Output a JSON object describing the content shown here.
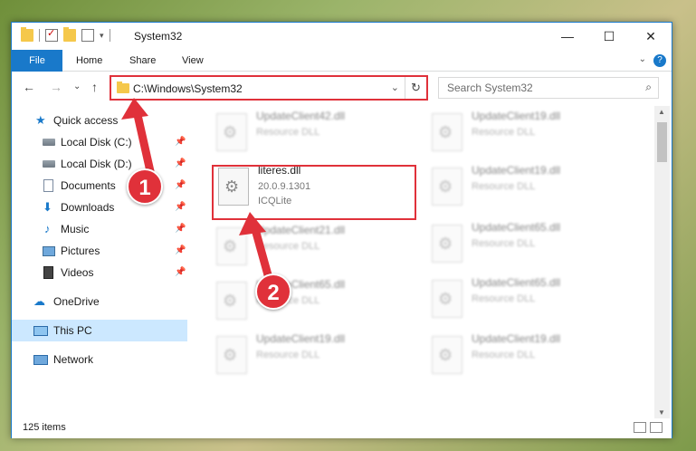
{
  "window": {
    "title": "System32",
    "minimize_glyph": "—",
    "maximize_glyph": "☐",
    "close_glyph": "✕"
  },
  "ribbon": {
    "tabs": [
      "File",
      "Home",
      "Share",
      "View"
    ],
    "help_glyph": "?",
    "collapse_glyph": "⌄"
  },
  "nav": {
    "back_glyph": "←",
    "forward_glyph": "→",
    "recent_glyph": "⌄",
    "up_glyph": "↑",
    "address_path": "C:\\Windows\\System32",
    "address_dropdown_glyph": "⌄",
    "refresh_glyph": "↻",
    "search_placeholder": "Search System32",
    "search_glyph": "⌕"
  },
  "sidebar": {
    "items": [
      {
        "label": "Quick access",
        "icon": "star-icon",
        "glyph": "★"
      },
      {
        "label": "Local Disk (C:)",
        "icon": "drive-icon",
        "pinned": true
      },
      {
        "label": "Local Disk (D:)",
        "icon": "drive-icon",
        "pinned": true
      },
      {
        "label": "Documents",
        "icon": "document-icon",
        "pinned": true
      },
      {
        "label": "Downloads",
        "icon": "download-icon",
        "glyph": "⬇",
        "pinned": true
      },
      {
        "label": "Music",
        "icon": "music-icon",
        "glyph": "♪",
        "pinned": true
      },
      {
        "label": "Pictures",
        "icon": "pictures-icon",
        "pinned": true
      },
      {
        "label": "Videos",
        "icon": "videos-icon",
        "pinned": true
      },
      {
        "label": "OneDrive",
        "icon": "cloud-icon",
        "glyph": "☁"
      },
      {
        "label": "This PC",
        "icon": "computer-icon",
        "selected": true
      },
      {
        "label": "Network",
        "icon": "network-icon"
      }
    ],
    "pin_glyph": "📌"
  },
  "files": {
    "highlighted": {
      "name": "literes.dll",
      "version": "20.0.9.1301",
      "company": "ICQLite"
    },
    "left_column": [
      {
        "name": "UpdateClient42.dll",
        "type": "Resource DLL"
      },
      {
        "name": "UpdateClient21.dll",
        "type": "Resource DLL"
      },
      {
        "name": "UpdateClient65.dll",
        "type": "Resource DLL"
      },
      {
        "name": "UpdateClient19.dll",
        "type": "Resource DLL"
      }
    ],
    "right_column": [
      {
        "name": "UpdateClient19.dll",
        "type": "Resource DLL"
      },
      {
        "name": "UpdateClient19.dll",
        "type": "Resource DLL"
      },
      {
        "name": "UpdateClient65.dll",
        "type": "Resource DLL"
      },
      {
        "name": "UpdateClient65.dll",
        "type": "Resource DLL"
      },
      {
        "name": "UpdateClient19.dll",
        "type": "Resource DLL"
      }
    ]
  },
  "status": {
    "item_count": "125 items"
  },
  "annotations": {
    "step1": "1",
    "step2": "2",
    "accent_color": "#e0313a"
  },
  "colors": {
    "accent": "#1979ca",
    "selection": "#cce8ff",
    "highlight": "#e0313a"
  }
}
